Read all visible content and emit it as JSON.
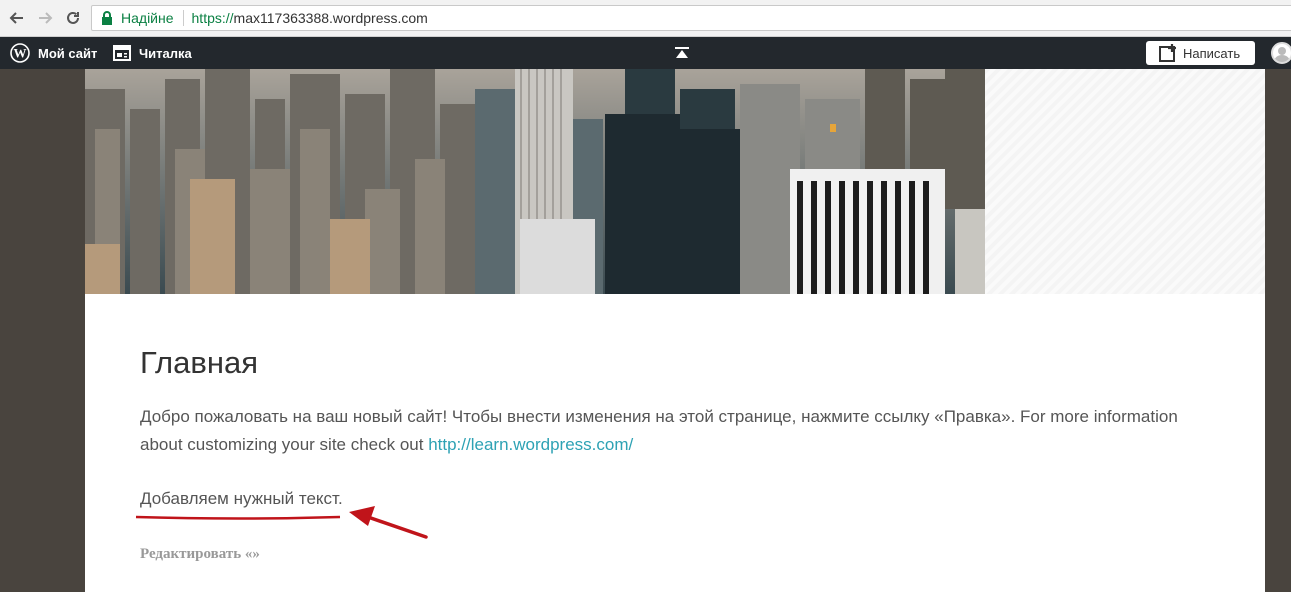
{
  "browser": {
    "secure_label": "Надійне",
    "url_scheme": "https://",
    "url_host": "max117363388.wordpress.com"
  },
  "adminbar": {
    "my_site": "Мой сайт",
    "reader": "Читалка",
    "write": "Написать"
  },
  "content": {
    "title": "Главная",
    "intro_text": "Добро пожаловать на ваш новый сайт! Чтобы внести изменения на этой странице, нажмите ссылку «Правка». For more information about customizing your site check out ",
    "intro_link": "http://learn.wordpress.com/",
    "added_text": "Добавляем нужный текст.",
    "edit_link": "Редактировать «»"
  },
  "colors": {
    "admin_bar": "#23282d",
    "link": "#2ea2b4",
    "annotation": "#c0141a",
    "secure": "#0b8043"
  }
}
